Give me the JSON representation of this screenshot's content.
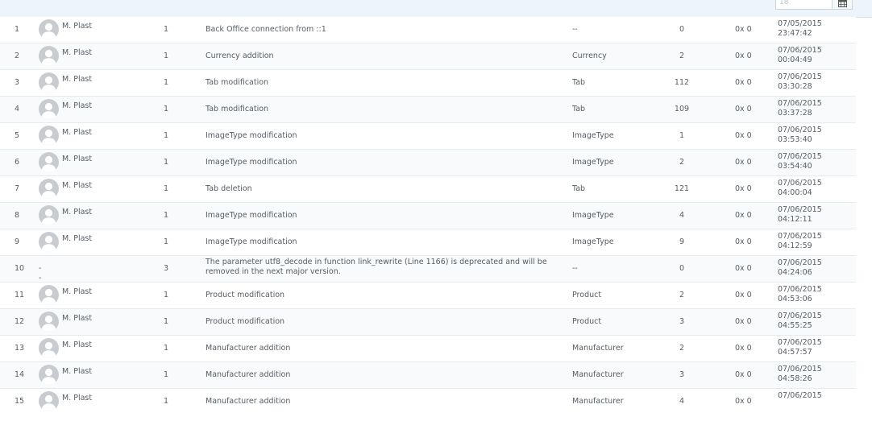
{
  "filters": {
    "date_value": "18"
  },
  "icons": {
    "calendar": "calendar-icon",
    "avatar": "user-avatar-icon"
  },
  "rows": [
    {
      "id": "1",
      "employee": "M. Plast",
      "has_avatar": true,
      "severity": "1",
      "message": "Back Office connection from ::1",
      "object_type": "--",
      "object_id": "0",
      "error_code": "0x 0",
      "date": "07/05/2015",
      "time": "23:47:42"
    },
    {
      "id": "2",
      "employee": "M. Plast",
      "has_avatar": true,
      "severity": "1",
      "message": "Currency addition",
      "object_type": "Currency",
      "object_id": "2",
      "error_code": "0x 0",
      "date": "07/06/2015",
      "time": "00:04:49"
    },
    {
      "id": "3",
      "employee": "M. Plast",
      "has_avatar": true,
      "severity": "1",
      "message": "Tab modification",
      "object_type": "Tab",
      "object_id": "112",
      "error_code": "0x 0",
      "date": "07/06/2015",
      "time": "03:30:28"
    },
    {
      "id": "4",
      "employee": "M. Plast",
      "has_avatar": true,
      "severity": "1",
      "message": "Tab modification",
      "object_type": "Tab",
      "object_id": "109",
      "error_code": "0x 0",
      "date": "07/06/2015",
      "time": "03:37:28"
    },
    {
      "id": "5",
      "employee": "M. Plast",
      "has_avatar": true,
      "severity": "1",
      "message": "ImageType modification",
      "object_type": "ImageType",
      "object_id": "1",
      "error_code": "0x 0",
      "date": "07/06/2015",
      "time": "03:53:40"
    },
    {
      "id": "6",
      "employee": "M. Plast",
      "has_avatar": true,
      "severity": "1",
      "message": "ImageType modification",
      "object_type": "ImageType",
      "object_id": "2",
      "error_code": "0x 0",
      "date": "07/06/2015",
      "time": "03:54:40"
    },
    {
      "id": "7",
      "employee": "M. Plast",
      "has_avatar": true,
      "severity": "1",
      "message": "Tab deletion",
      "object_type": "Tab",
      "object_id": "121",
      "error_code": "0x 0",
      "date": "07/06/2015",
      "time": "04:00:04"
    },
    {
      "id": "8",
      "employee": "M. Plast",
      "has_avatar": true,
      "severity": "1",
      "message": "ImageType modification",
      "object_type": "ImageType",
      "object_id": "4",
      "error_code": "0x 0",
      "date": "07/06/2015",
      "time": "04:12:11"
    },
    {
      "id": "9",
      "employee": "M. Plast",
      "has_avatar": true,
      "severity": "1",
      "message": "ImageType modification",
      "object_type": "ImageType",
      "object_id": "9",
      "error_code": "0x 0",
      "date": "07/06/2015",
      "time": "04:12:59"
    },
    {
      "id": "10",
      "employee": "--",
      "has_avatar": false,
      "severity": "3",
      "message": "The parameter utf8_decode in function link_rewrite (Line 1166) is deprecated and will be removed in the next major version.",
      "object_type": "--",
      "object_id": "0",
      "error_code": "0x 0",
      "date": "07/06/2015",
      "time": "04:24:06"
    },
    {
      "id": "11",
      "employee": "M. Plast",
      "has_avatar": true,
      "severity": "1",
      "message": "Product modification",
      "object_type": "Product",
      "object_id": "2",
      "error_code": "0x 0",
      "date": "07/06/2015",
      "time": "04:53:06"
    },
    {
      "id": "12",
      "employee": "M. Plast",
      "has_avatar": true,
      "severity": "1",
      "message": "Product modification",
      "object_type": "Product",
      "object_id": "3",
      "error_code": "0x 0",
      "date": "07/06/2015",
      "time": "04:55:25"
    },
    {
      "id": "13",
      "employee": "M. Plast",
      "has_avatar": true,
      "severity": "1",
      "message": "Manufacturer addition",
      "object_type": "Manufacturer",
      "object_id": "2",
      "error_code": "0x 0",
      "date": "07/06/2015",
      "time": "04:57:57"
    },
    {
      "id": "14",
      "employee": "M. Plast",
      "has_avatar": true,
      "severity": "1",
      "message": "Manufacturer addition",
      "object_type": "Manufacturer",
      "object_id": "3",
      "error_code": "0x 0",
      "date": "07/06/2015",
      "time": "04:58:26"
    },
    {
      "id": "15",
      "employee": "M. Plast",
      "has_avatar": true,
      "severity": "1",
      "message": "Manufacturer addition",
      "object_type": "Manufacturer",
      "object_id": "4",
      "error_code": "0x 0",
      "date": "07/06/2015",
      "time": ""
    }
  ]
}
